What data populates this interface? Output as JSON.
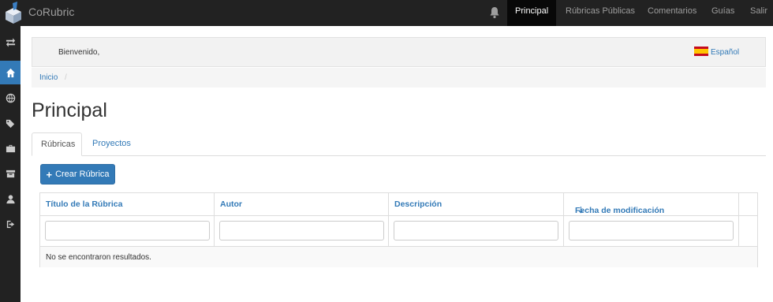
{
  "app": {
    "brand": "CoRubric"
  },
  "topnav": {
    "items": [
      {
        "label": "Principal",
        "active": true
      },
      {
        "label": "Rúbricas Públicas"
      },
      {
        "label": "Comentarios"
      },
      {
        "label": "Guías"
      },
      {
        "label": "Salir"
      }
    ]
  },
  "sidebar": {
    "items": [
      {
        "icon": "swap-arrows-icon"
      },
      {
        "icon": "home-icon",
        "active": true
      },
      {
        "icon": "globe-icon"
      },
      {
        "icon": "tags-icon"
      },
      {
        "icon": "briefcase-icon"
      },
      {
        "icon": "archive-icon"
      },
      {
        "icon": "user-icon"
      },
      {
        "icon": "logout-icon"
      }
    ]
  },
  "header": {
    "welcome": "Bienvenido,",
    "language": "Español"
  },
  "breadcrumb": {
    "home": "Inicio",
    "separator": "/"
  },
  "page": {
    "title": "Principal"
  },
  "tabs": [
    {
      "label": "Rúbricas",
      "active": true
    },
    {
      "label": "Proyectos"
    }
  ],
  "actions": {
    "create_label": "Crear Rúbrica"
  },
  "table": {
    "columns": [
      "Título de la Rúbrica",
      "Autor",
      "Descripción",
      "Fecha de modificación"
    ],
    "empty_message": "No se encontraron resultados."
  },
  "colors": {
    "accent": "#337ab7",
    "navbar": "#222222"
  }
}
